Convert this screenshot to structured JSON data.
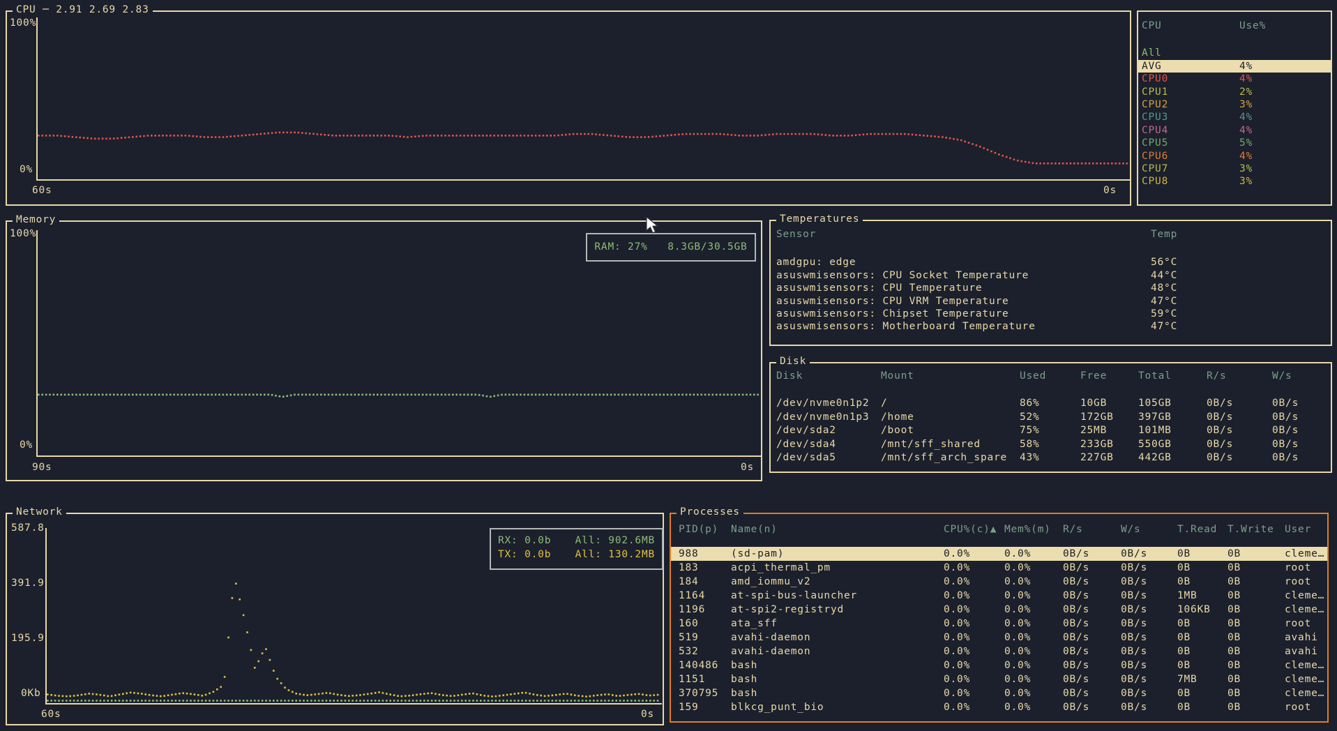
{
  "colors": {
    "background": "#1b202c",
    "foreground": "#e9d8a7",
    "table_header": "#7d9e8c",
    "accent_green": "#8fbc75",
    "accent_yellow": "#e2c13e",
    "accent_red": "#e25549",
    "selection_bg": "#ecddae",
    "selected_widget_border": "#e57d1e",
    "info_box_border": "#b4b8b6"
  },
  "cpu_panel": {
    "title": "CPU",
    "load_average": "2.91 2.69 2.83",
    "y_top": "100%",
    "y_bottom": "0%",
    "x_left": "60s",
    "x_right": "0s"
  },
  "cpu_legend": {
    "col_cpu": "CPU",
    "col_use": "Use%",
    "rows": [
      {
        "label": "All",
        "value": "",
        "color": "#8fbc75"
      },
      {
        "label": "AVG",
        "value": "4%",
        "color": "#e9d8a7",
        "selected": true
      },
      {
        "label": "CPU0",
        "value": "4%",
        "color": "#e25549"
      },
      {
        "label": "CPU1",
        "value": "2%",
        "color": "#b8bb4e"
      },
      {
        "label": "CPU2",
        "value": "3%",
        "color": "#d6a13c"
      },
      {
        "label": "CPU3",
        "value": "4%",
        "color": "#57958d"
      },
      {
        "label": "CPU4",
        "value": "4%",
        "color": "#c4678f"
      },
      {
        "label": "CPU5",
        "value": "5%",
        "color": "#74aa68"
      },
      {
        "label": "CPU6",
        "value": "4%",
        "color": "#dd7d33"
      },
      {
        "label": "CPU7",
        "value": "3%",
        "color": "#b8bb4e"
      },
      {
        "label": "CPU8",
        "value": "3%",
        "color": "#d6b13c"
      }
    ]
  },
  "memory_panel": {
    "title": "Memory",
    "y_top": "100%",
    "y_bottom": "0%",
    "x_left": "90s",
    "x_right": "0s",
    "ram_badge": "RAM: 27%   8.3GB/30.5GB"
  },
  "temperatures": {
    "title": "Temperatures",
    "col_sensor": "Sensor",
    "col_temp": "Temp",
    "rows": [
      {
        "sensor": "amdgpu: edge",
        "temp": "56°C"
      },
      {
        "sensor": "asuswmisensors: CPU Socket Temperature",
        "temp": "44°C"
      },
      {
        "sensor": "asuswmisensors: CPU Temperature",
        "temp": "48°C"
      },
      {
        "sensor": "asuswmisensors: CPU VRM Temperature",
        "temp": "47°C"
      },
      {
        "sensor": "asuswmisensors: Chipset Temperature",
        "temp": "59°C"
      },
      {
        "sensor": "asuswmisensors: Motherboard Temperature",
        "temp": "47°C"
      }
    ]
  },
  "disk": {
    "title": "Disk",
    "headers": {
      "disk": "Disk",
      "mount": "Mount",
      "used": "Used",
      "free": "Free",
      "total": "Total",
      "rs": "R/s",
      "ws": "W/s"
    },
    "rows": [
      {
        "disk": "/dev/nvme0n1p2",
        "mount": "/",
        "used": "86%",
        "free": "10GB",
        "total": "105GB",
        "rs": "0B/s",
        "ws": "0B/s"
      },
      {
        "disk": "/dev/nvme0n1p3",
        "mount": "/home",
        "used": "52%",
        "free": "172GB",
        "total": "397GB",
        "rs": "0B/s",
        "ws": "0B/s"
      },
      {
        "disk": "/dev/sda2",
        "mount": "/boot",
        "used": "75%",
        "free": "25MB",
        "total": "101MB",
        "rs": "0B/s",
        "ws": "0B/s"
      },
      {
        "disk": "/dev/sda4",
        "mount": "/mnt/sff_shared",
        "used": "58%",
        "free": "233GB",
        "total": "550GB",
        "rs": "0B/s",
        "ws": "0B/s"
      },
      {
        "disk": "/dev/sda5",
        "mount": "/mnt/sff_arch_spare",
        "used": "43%",
        "free": "227GB",
        "total": "442GB",
        "rs": "0B/s",
        "ws": "0B/s"
      }
    ]
  },
  "network": {
    "title": "Network",
    "y_labels": [
      "587.8",
      "391.9",
      "195.9",
      "0Kb"
    ],
    "x_left": "60s",
    "x_right": "0s",
    "rx_label": "RX: 0.0b",
    "rx_total": "All: 902.6MB",
    "tx_label": "TX: 0.0b",
    "tx_total": "All: 130.2MB"
  },
  "processes": {
    "title": "Processes",
    "headers": {
      "pid": "PID(p)",
      "name": "Name(n)",
      "cpu": "CPU%(c)▲",
      "mem": "Mem%(m)",
      "rs": "R/s",
      "ws": "W/s",
      "tread": "T.Read",
      "twrite": "T.Write",
      "user": "User"
    },
    "rows": [
      {
        "pid": "988",
        "name": "(sd-pam)",
        "cpu": "0.0%",
        "mem": "0.0%",
        "rs": "0B/s",
        "ws": "0B/s",
        "tread": "0B",
        "twrite": "0B",
        "user": "cleme…",
        "selected": true
      },
      {
        "pid": "183",
        "name": "acpi_thermal_pm",
        "cpu": "0.0%",
        "mem": "0.0%",
        "rs": "0B/s",
        "ws": "0B/s",
        "tread": "0B",
        "twrite": "0B",
        "user": "root"
      },
      {
        "pid": "184",
        "name": "amd_iommu_v2",
        "cpu": "0.0%",
        "mem": "0.0%",
        "rs": "0B/s",
        "ws": "0B/s",
        "tread": "0B",
        "twrite": "0B",
        "user": "root"
      },
      {
        "pid": "1164",
        "name": "at-spi-bus-launcher",
        "cpu": "0.0%",
        "mem": "0.0%",
        "rs": "0B/s",
        "ws": "0B/s",
        "tread": "1MB",
        "twrite": "0B",
        "user": "cleme…"
      },
      {
        "pid": "1196",
        "name": "at-spi2-registryd",
        "cpu": "0.0%",
        "mem": "0.0%",
        "rs": "0B/s",
        "ws": "0B/s",
        "tread": "106KB",
        "twrite": "0B",
        "user": "cleme…"
      },
      {
        "pid": "160",
        "name": "ata_sff",
        "cpu": "0.0%",
        "mem": "0.0%",
        "rs": "0B/s",
        "ws": "0B/s",
        "tread": "0B",
        "twrite": "0B",
        "user": "root"
      },
      {
        "pid": "519",
        "name": "avahi-daemon",
        "cpu": "0.0%",
        "mem": "0.0%",
        "rs": "0B/s",
        "ws": "0B/s",
        "tread": "0B",
        "twrite": "0B",
        "user": "avahi"
      },
      {
        "pid": "532",
        "name": "avahi-daemon",
        "cpu": "0.0%",
        "mem": "0.0%",
        "rs": "0B/s",
        "ws": "0B/s",
        "tread": "0B",
        "twrite": "0B",
        "user": "avahi"
      },
      {
        "pid": "140486",
        "name": "bash",
        "cpu": "0.0%",
        "mem": "0.0%",
        "rs": "0B/s",
        "ws": "0B/s",
        "tread": "0B",
        "twrite": "0B",
        "user": "cleme…"
      },
      {
        "pid": "1151",
        "name": "bash",
        "cpu": "0.0%",
        "mem": "0.0%",
        "rs": "0B/s",
        "ws": "0B/s",
        "tread": "7MB",
        "twrite": "0B",
        "user": "cleme…"
      },
      {
        "pid": "370795",
        "name": "bash",
        "cpu": "0.0%",
        "mem": "0.0%",
        "rs": "0B/s",
        "ws": "0B/s",
        "tread": "0B",
        "twrite": "0B",
        "user": "cleme…"
      },
      {
        "pid": "159",
        "name": "blkcg_punt_bio",
        "cpu": "0.0%",
        "mem": "0.0%",
        "rs": "0B/s",
        "ws": "0B/s",
        "tread": "0B",
        "twrite": "0B",
        "user": "root"
      }
    ]
  },
  "chart_data": [
    {
      "type": "line",
      "title": "CPU",
      "xlabel": "seconds ago (60s → 0s)",
      "ylabel": "Use%",
      "ylim": [
        0,
        100
      ],
      "grid": false,
      "series": [
        {
          "name": "AVG CPU %",
          "color": "#e25549",
          "values": [
            27,
            27,
            26,
            25,
            25,
            26,
            27,
            27,
            27,
            26,
            26,
            27,
            28,
            29,
            29,
            28,
            27,
            27,
            27,
            27,
            26,
            27,
            27,
            27,
            27,
            27,
            27,
            27,
            27,
            28,
            28,
            27,
            26,
            26,
            27,
            28,
            28,
            28,
            27,
            27,
            28,
            28,
            28,
            27,
            27,
            28,
            28,
            28,
            27,
            26,
            24,
            20,
            15,
            11,
            9,
            9,
            9,
            9,
            9,
            9
          ]
        }
      ]
    },
    {
      "type": "line",
      "title": "Memory",
      "xlabel": "seconds ago (90s → 0s)",
      "ylabel": "RAM %",
      "ylim": [
        0,
        100
      ],
      "grid": false,
      "series": [
        {
          "name": "RAM % (27%, 8.3GB/30.5GB)",
          "color": "#8fbc75",
          "values": [
            27,
            27,
            27,
            27,
            27,
            27,
            27,
            27,
            27,
            27,
            27,
            27,
            27,
            27,
            27,
            27,
            27,
            27,
            27,
            27,
            26,
            27,
            27,
            27,
            27,
            27,
            27,
            27,
            27,
            27,
            27,
            27,
            27,
            27,
            27,
            27,
            27,
            26,
            27,
            27,
            27,
            27,
            27,
            27,
            27,
            27,
            27,
            27,
            27,
            27,
            27,
            27,
            27,
            27,
            27,
            27,
            27,
            27,
            27,
            27
          ]
        }
      ]
    },
    {
      "type": "line",
      "title": "Network",
      "xlabel": "seconds ago (60s → 0s)",
      "ylabel": "Kb",
      "ylim": [
        0,
        620
      ],
      "y_ticks": [
        587.8,
        391.9,
        195.9,
        0
      ],
      "grid": false,
      "series": [
        {
          "name": "RX Kb",
          "color": "#8fbc75",
          "values": [
            2,
            2,
            2,
            2,
            2,
            2,
            2,
            2,
            2,
            2,
            2,
            2,
            2,
            2,
            2,
            2,
            2,
            2,
            2,
            2,
            2,
            2,
            2,
            2,
            2,
            2,
            2,
            2,
            2,
            2,
            2,
            2,
            2,
            2,
            2,
            2,
            2,
            2,
            2,
            2,
            2,
            2,
            2,
            2,
            2,
            2,
            2,
            2,
            2,
            2,
            2,
            2,
            2,
            2,
            2,
            2,
            2,
            2,
            2,
            2
          ]
        },
        {
          "name": "TX Kb",
          "color": "#e2c13e",
          "values": [
            25,
            20,
            18,
            22,
            28,
            24,
            18,
            25,
            32,
            28,
            22,
            18,
            24,
            30,
            26,
            20,
            35,
            60,
            460,
            300,
            120,
            200,
            90,
            45,
            28,
            22,
            26,
            31,
            24,
            19,
            22,
            27,
            33,
            25,
            18,
            21,
            26,
            30,
            23,
            19,
            24,
            29,
            21,
            17,
            22,
            27,
            32,
            24,
            19,
            23,
            28,
            21,
            17,
            22,
            26,
            19,
            23,
            27,
            21,
            24
          ]
        }
      ]
    }
  ]
}
